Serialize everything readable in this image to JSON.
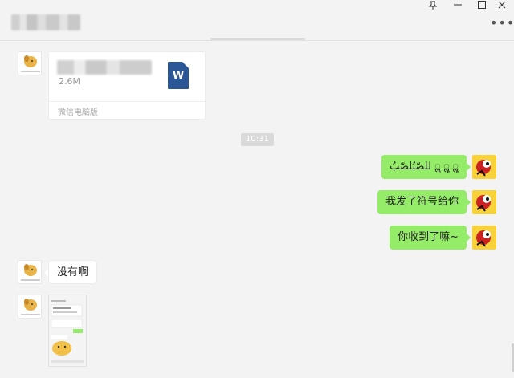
{
  "window": {
    "pin_icon": "pin-icon",
    "minimize_icon": "minimize-icon",
    "maximize_icon": "maximize-icon",
    "close_icon": "close-icon",
    "more_icon": "more-icon"
  },
  "file_message": {
    "size": "2.6M",
    "source": "微信电脑版",
    "icon": "word-file-icon",
    "icon_letter": "W"
  },
  "timestamp": "10:31",
  "messages": [
    {
      "side": "right",
      "text": "للصّبُلصّبُ ॣ ॣ ॣ"
    },
    {
      "side": "right",
      "text": "我发了符号给你"
    },
    {
      "side": "right",
      "text": "你收到了嘛~"
    },
    {
      "side": "left",
      "text": "没有啊"
    }
  ],
  "colors": {
    "background": "#f3f3f3",
    "bubble_self": "#95ec69",
    "bubble_other": "#ffffff",
    "word_blue": "#2b5797"
  }
}
